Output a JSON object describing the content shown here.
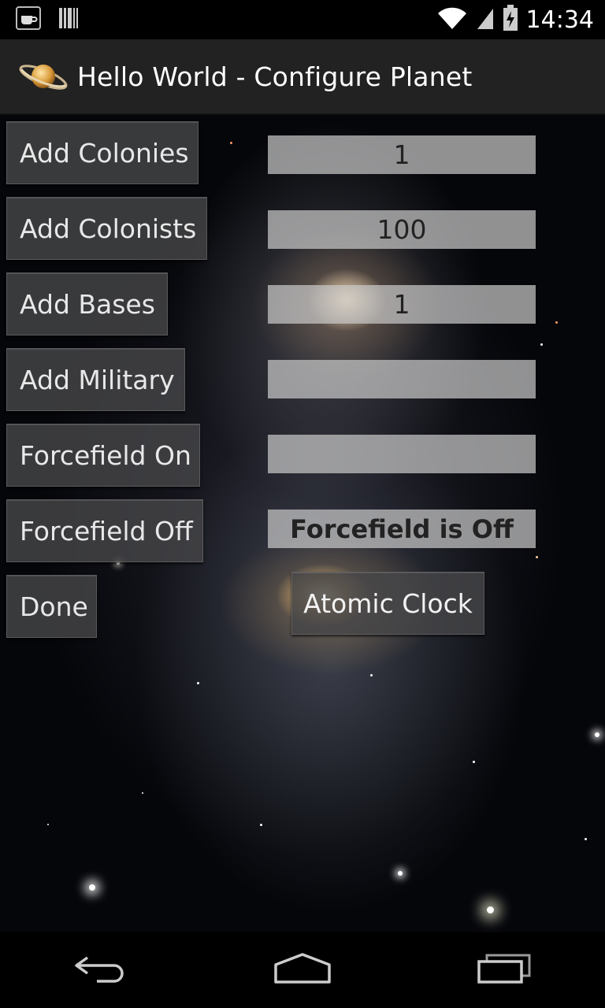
{
  "status_bar": {
    "time": "14:34",
    "icons": [
      "coffee-cup-icon",
      "barcode-icon",
      "wifi-icon",
      "signal-icon",
      "battery-charging-icon"
    ]
  },
  "action_bar": {
    "title": "Hello World - Configure Planet",
    "app_icon": "saturn-planet-icon"
  },
  "buttons": {
    "add_colonies": "Add Colonies",
    "add_colonists": "Add Colonists",
    "add_bases": "Add Bases",
    "add_military": "Add Military",
    "forcefield_on": "Forcefield On",
    "forcefield_off": "Forcefield Off",
    "done": "Done",
    "atomic_clock": "Atomic Clock"
  },
  "fields": {
    "colonies": "1",
    "colonists": "100",
    "bases": "1",
    "military": "",
    "forcefield_on": "",
    "forcefield_status": "Forcefield is Off"
  },
  "nav_bar": {
    "icons": [
      "back-icon",
      "home-icon",
      "recent-apps-icon"
    ]
  }
}
